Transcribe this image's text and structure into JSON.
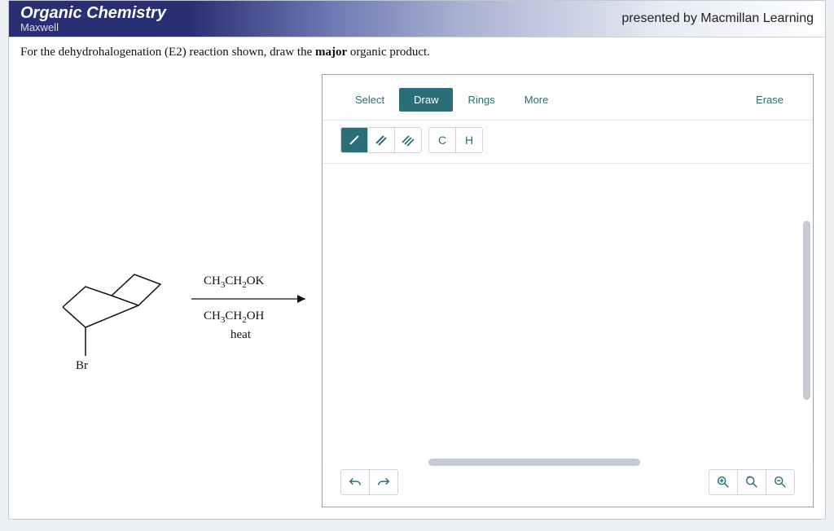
{
  "header": {
    "course": "Organic Chemistry",
    "author": "Maxwell",
    "presented": "presented by Macmillan Learning"
  },
  "question": {
    "prefix": "For the dehydrohalogenation (E2) reaction shown, draw the ",
    "bold": "major",
    "suffix": " organic product."
  },
  "reaction": {
    "reagent_top": "CH3CH2OK",
    "reagent_bottom": "CH3CH2OH",
    "condition": "heat",
    "leaving_group": "Br"
  },
  "editor": {
    "tabs": {
      "select": "Select",
      "draw": "Draw",
      "rings": "Rings",
      "more": "More"
    },
    "erase": "Erase",
    "tools": {
      "single": "/",
      "double": "//",
      "triple": "///",
      "carbon": "C",
      "hydrogen": "H"
    }
  }
}
